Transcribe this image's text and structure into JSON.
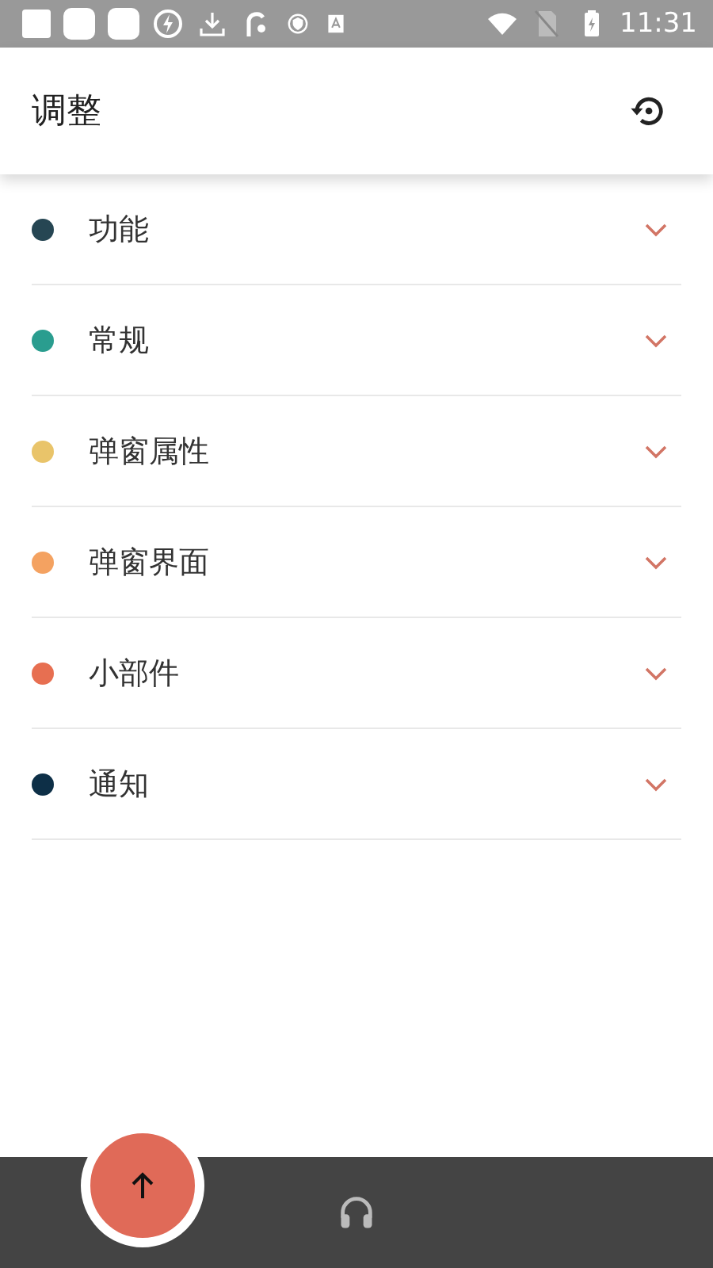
{
  "status_bar": {
    "time": "11:31"
  },
  "app_bar": {
    "title": "调整"
  },
  "sections": [
    {
      "label": "功能",
      "color": "#264653",
      "expanded": false
    },
    {
      "label": "常规",
      "color": "#2a9d8f",
      "expanded": false
    },
    {
      "label": "弹窗属性",
      "color": "#e9c46a",
      "expanded": false
    },
    {
      "label": "弹窗界面",
      "color": "#f4a261",
      "expanded": false
    },
    {
      "label": "小部件",
      "color": "#e76f51",
      "expanded": false
    },
    {
      "label": "通知",
      "color": "#0d2f47",
      "expanded": false
    }
  ]
}
